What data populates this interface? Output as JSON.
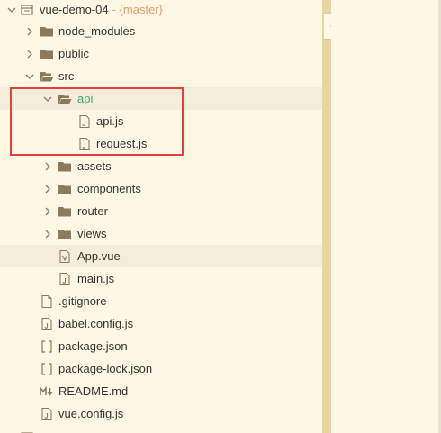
{
  "explorer": {
    "project": {
      "name": "vue-demo-04",
      "branch": "- {master}"
    },
    "items": [
      {
        "label": "node_modules",
        "icon": "folder-icon",
        "expanded": false
      },
      {
        "label": "public",
        "icon": "folder-icon",
        "expanded": false
      },
      {
        "label": "src",
        "icon": "folder-icon",
        "expanded": true
      },
      {
        "label": "api",
        "icon": "folder-open-icon",
        "expanded": true,
        "selected": true
      },
      {
        "label": "api.js",
        "icon": "js-file-icon"
      },
      {
        "label": "request.js",
        "icon": "js-file-icon"
      },
      {
        "label": "assets",
        "icon": "folder-icon",
        "expanded": false
      },
      {
        "label": "components",
        "icon": "folder-icon",
        "expanded": false
      },
      {
        "label": "router",
        "icon": "folder-icon",
        "expanded": false
      },
      {
        "label": "views",
        "icon": "folder-icon",
        "expanded": false
      },
      {
        "label": "App.vue",
        "icon": "vue-file-icon"
      },
      {
        "label": "main.js",
        "icon": "js-file-icon"
      },
      {
        "label": ".gitignore",
        "icon": "file-icon"
      },
      {
        "label": "babel.config.js",
        "icon": "js-file-icon"
      },
      {
        "label": "package.json",
        "icon": "json-file-icon"
      },
      {
        "label": "package-lock.json",
        "icon": "json-file-icon"
      },
      {
        "label": "README.md",
        "icon": "markdown-file-icon"
      },
      {
        "label": "vue.config.js",
        "icon": "js-file-icon"
      }
    ]
  },
  "colors": {
    "background": "#fdf7e4",
    "selected_text": "#3ca86b",
    "branch_text": "#e0a072",
    "highlight_box": "#e23f3f",
    "divider": "#ead5a0",
    "icon": "#8c7a5a"
  }
}
